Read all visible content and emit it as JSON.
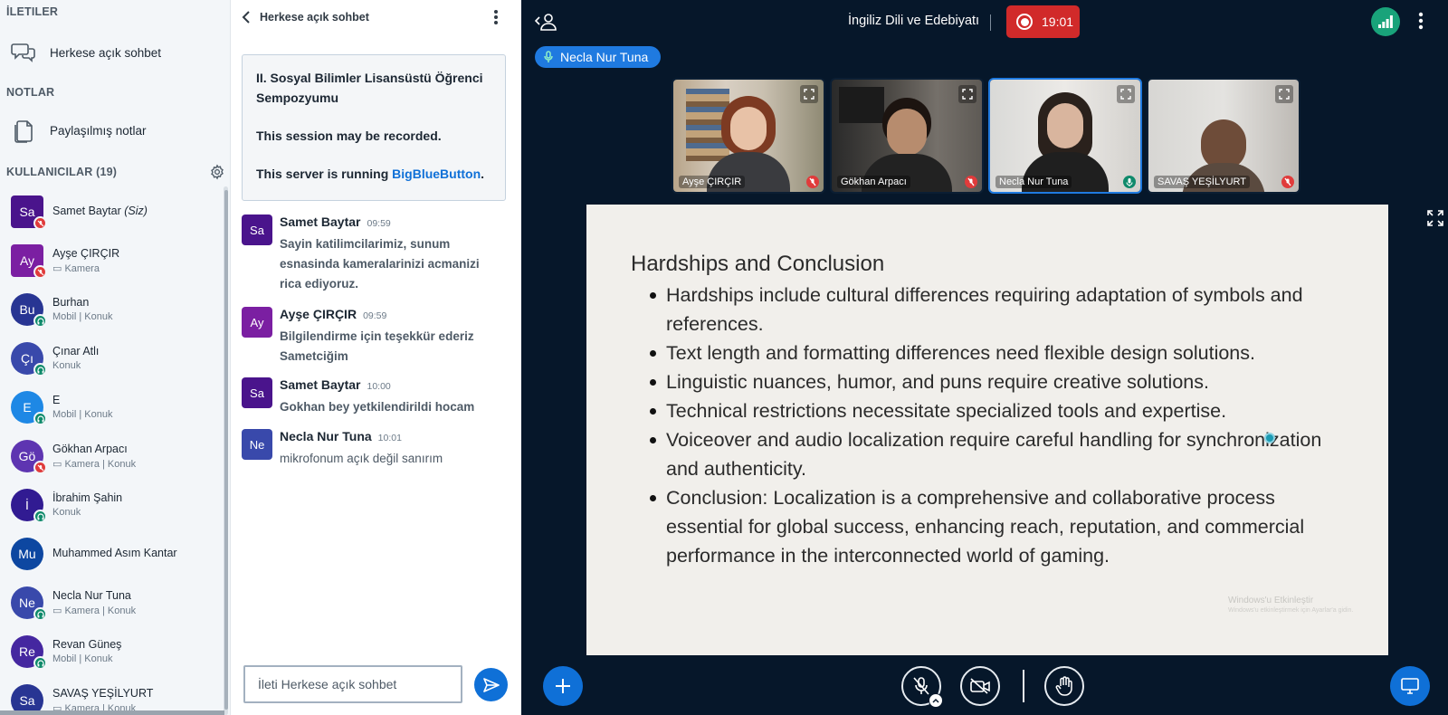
{
  "sidebar": {
    "messages_title": "İLETILER",
    "public_chat_label": "Herkese açık sohbet",
    "notes_title": "NOTLAR",
    "shared_notes_label": "Paylaşılmış notlar",
    "users_title": "KULLANICILAR (19)",
    "users": [
      {
        "initials": "Sa",
        "name": "Samet Baytar",
        "you": "(Siz)",
        "sub": "",
        "color": "#4a148c",
        "badge": "muted",
        "shape": "square"
      },
      {
        "initials": "Ay",
        "name": "Ayşe ÇIRÇIR",
        "you": "",
        "sub": "▭ Kamera",
        "color": "#7b1fa2",
        "badge": "muted",
        "shape": "square"
      },
      {
        "initials": "Bu",
        "name": "Burhan",
        "you": "",
        "sub": "Mobil | Konuk",
        "color": "#283593",
        "badge": "listen",
        "shape": "round"
      },
      {
        "initials": "Çı",
        "name": "Çınar Atlı",
        "you": "",
        "sub": "Konuk",
        "color": "#3949ab",
        "badge": "listen",
        "shape": "round"
      },
      {
        "initials": "E",
        "name": "E",
        "you": "",
        "sub": "Mobil | Konuk",
        "color": "#1e88e5",
        "badge": "listen",
        "shape": "round"
      },
      {
        "initials": "Gö",
        "name": "Gökhan Arpacı",
        "you": "",
        "sub": "▭ Kamera | Konuk",
        "color": "#5e35b1",
        "badge": "muted",
        "shape": "round"
      },
      {
        "initials": "İ",
        "name": "İbrahim Şahin",
        "you": "",
        "sub": "Konuk",
        "color": "#311b92",
        "badge": "listen",
        "shape": "round"
      },
      {
        "initials": "Mu",
        "name": "Muhammed Asım Kantar",
        "you": "",
        "sub": "",
        "color": "#0d47a1",
        "badge": "none",
        "shape": "round"
      },
      {
        "initials": "Ne",
        "name": "Necla Nur Tuna",
        "you": "",
        "sub": "▭ Kamera | Konuk",
        "color": "#3949ab",
        "badge": "listen",
        "shape": "round"
      },
      {
        "initials": "Re",
        "name": "Revan Güneş",
        "you": "",
        "sub": "Mobil | Konuk",
        "color": "#4527a0",
        "badge": "listen",
        "shape": "round"
      },
      {
        "initials": "Sa",
        "name": "SAVAŞ YEŞİLYURT",
        "you": "",
        "sub": "▭ Kamera | Konuk",
        "color": "#283593",
        "badge": "none",
        "shape": "round"
      }
    ]
  },
  "chat": {
    "title": "Herkese açık sohbet",
    "welcome_line1": "II. Sosyal Bilimler Lisansüstü Öğrenci Sempozyumu",
    "welcome_line2": "This session may be recorded.",
    "welcome_line3_prefix": "This server is running ",
    "welcome_line3_link": "BigBlueButton",
    "welcome_line3_suffix": ".",
    "messages": [
      {
        "initials": "Sa",
        "author": "Samet Baytar",
        "time": "09:59",
        "text": "Sayin katilimcilarimiz, sunum esnasinda kameralarinizi acmanizi rica ediyoruz.",
        "color": "#4a148c"
      },
      {
        "initials": "Ay",
        "author": "Ayşe ÇIRÇIR",
        "time": "09:59",
        "text": "Bilgilendirme için teşekkür ederiz Sametciğim",
        "color": "#7b1fa2"
      },
      {
        "initials": "Sa",
        "author": "Samet Baytar",
        "time": "10:00",
        "text": "Gokhan bey yetkilendirildi hocam",
        "color": "#4a148c"
      },
      {
        "initials": "Ne",
        "author": "Necla Nur Tuna",
        "time": "10:01",
        "text": "mikrofonum açık değil sanırım",
        "color": "#3949ab"
      }
    ],
    "input_placeholder": "İleti Herkese açık sohbet"
  },
  "main": {
    "meeting_title": "İngiliz Dili ve Edebiyatı",
    "record_time": "19:01",
    "talking_indicator": "Necla Nur Tuna",
    "videos": [
      {
        "name": "Ayşe ÇIRÇIR",
        "mic": "muted"
      },
      {
        "name": "Gökhan Arpacı",
        "mic": "muted"
      },
      {
        "name": "Necla Nur Tuna",
        "mic": "talking"
      },
      {
        "name": "SAVAŞ YEŞİLYURT",
        "mic": "muted"
      }
    ],
    "slide": {
      "title": "Hardships and Conclusion",
      "bullets": [
        "Hardships include cultural differences requiring adaptation of symbols and references.",
        "Text length and formatting differences need flexible design solutions.",
        "Linguistic nuances, humor, and puns require creative solutions.",
        "Technical restrictions necessitate specialized tools and expertise.",
        "Voiceover and audio localization require careful handling for synchronization and authenticity.",
        "Conclusion: Localization is a comprehensive and collaborative process essential for global success, enhancing reach, reputation, and commercial performance in the interconnected world of gaming."
      ],
      "watermark_title": "Windows'u Etkinleştir",
      "watermark_sub": "Windows'u etkinleştirmek için Ayarlar'a gidin."
    }
  },
  "colors": {
    "accent": "#0f70d7",
    "record_red": "#d12a2a",
    "muted_red": "#e03b3b",
    "listen_green": "#0f8a6b",
    "dark_bg": "#06172a"
  }
}
